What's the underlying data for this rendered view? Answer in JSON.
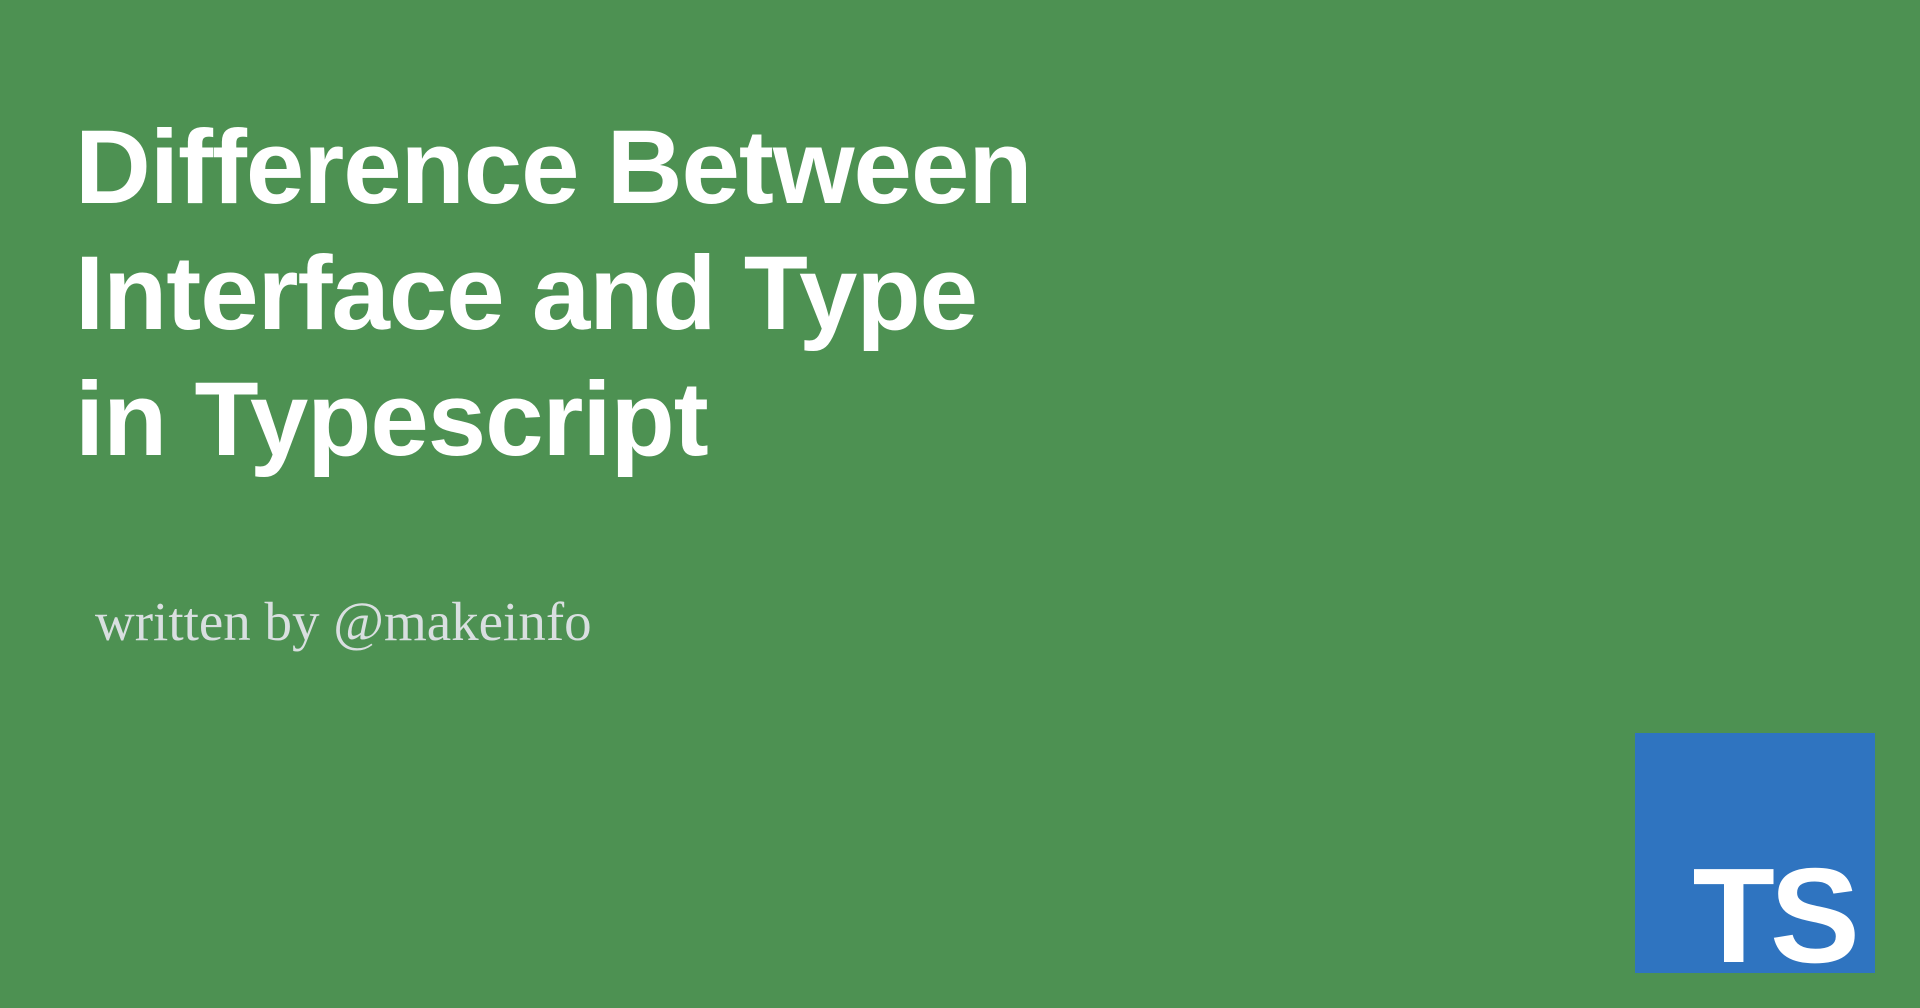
{
  "title": {
    "line1": "Difference Between",
    "line2": "Interface and Type",
    "line3": "in Typescript"
  },
  "byline": "written by @makeinfo",
  "logo": {
    "text": "TS"
  },
  "colors": {
    "background": "#4d9152",
    "title_text": "#ffffff",
    "byline_text": "#d9dfe0",
    "logo_bg": "#2f74c0",
    "logo_text": "#ffffff"
  }
}
